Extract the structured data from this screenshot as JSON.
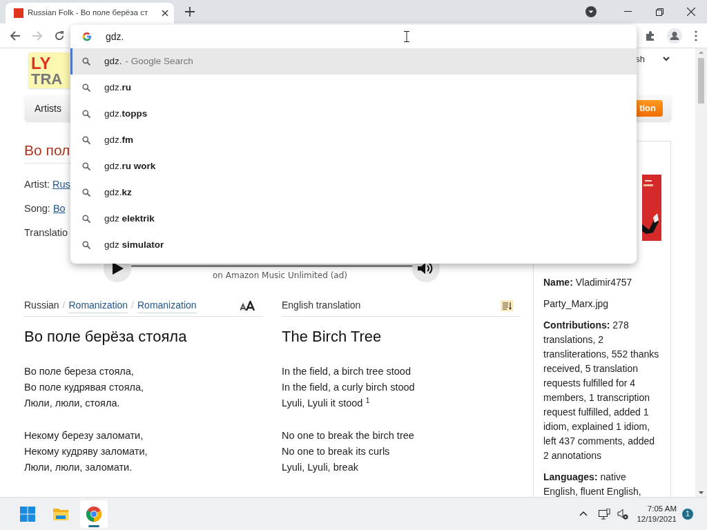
{
  "browser": {
    "tab": {
      "title": "Russian Folk - Во поле берёза ст",
      "selected": true
    },
    "address": {
      "value": "gdz."
    },
    "forward_disabled": true
  },
  "suggestions": [
    {
      "kind": "search",
      "text": "gdz.",
      "hint": "- Google Search",
      "selected": true
    },
    {
      "kind": "query",
      "text": "gdz.**ru**",
      "selected": false
    },
    {
      "kind": "query",
      "text": "gdz.**topps**",
      "selected": false
    },
    {
      "kind": "query",
      "text": "gdz.**fm**",
      "selected": false
    },
    {
      "kind": "query",
      "text": "gdz.**ru work**",
      "selected": false
    },
    {
      "kind": "query",
      "text": "gdz.**kz**",
      "selected": false
    },
    {
      "kind": "query",
      "text": "gdz **elektrik**",
      "selected": false
    },
    {
      "kind": "query",
      "text": "gdz **simulator**",
      "selected": false
    }
  ],
  "page": {
    "logo": [
      "LY",
      "TRA"
    ],
    "language_menu": "sh",
    "nav": [
      "Artists"
    ],
    "action_button": "tion",
    "title": "Во пол",
    "meta": [
      {
        "label": "Artist:",
        "value": "Rus"
      },
      {
        "label": "Song:",
        "value": "Во"
      },
      {
        "label": "Translatio"
      }
    ],
    "player": {
      "caption": "on Amazon Music Unlimited (ad)"
    },
    "lyrics": [
      {
        "separator": "/",
        "header": [
          {
            "text": "Russian",
            "selected": true
          },
          {
            "text": "Romanization",
            "selected": false
          },
          {
            "text": "Romanization",
            "selected": false
          }
        ],
        "title": "Во поле берёза стояла",
        "stanzas": [
          [
            "Во поле береза стояла,",
            "Во поле кудрявая стояла,",
            "Люли, люли, стояла."
          ],
          [
            "Некому березу заломати,",
            "Некому кудряву заломати,",
            "Люли, люли, заломати."
          ]
        ]
      },
      {
        "header": [
          {
            "text": "English translation",
            "selected": true
          }
        ],
        "title": "The Birch Tree",
        "stanzas": [
          [
            "In the field, a birch tree stood",
            "In the field, a curly birch stood",
            "Lyuli, Lyuli it stood $^{1}$"
          ],
          [
            "No one to break the birch tree",
            "No one to break its curls",
            "Lyuli, Lyuli, break"
          ]
        ]
      }
    ],
    "sidebar": {
      "name": "**Name:** Vladimir4757",
      "file": "Party_Marx.jpg",
      "contributions": "**Contributions:** 278 translations, 2 transliterations, 552 thanks received, 5 translation requests fulfilled for 4 members, 1 transcription request fulfilled, added 1 idiom, explained 1 idiom, left 437 comments, added 2 annotations",
      "languages": "**Languages:** native English, fluent English,"
    }
  },
  "taskbar": {
    "apps": [
      {
        "kind": "start",
        "selected": false
      },
      {
        "kind": "files",
        "selected": false
      },
      {
        "kind": "browser",
        "selected": true
      }
    ],
    "time": "7:05 AM",
    "date": "12/19/2021",
    "notifications": "1"
  }
}
